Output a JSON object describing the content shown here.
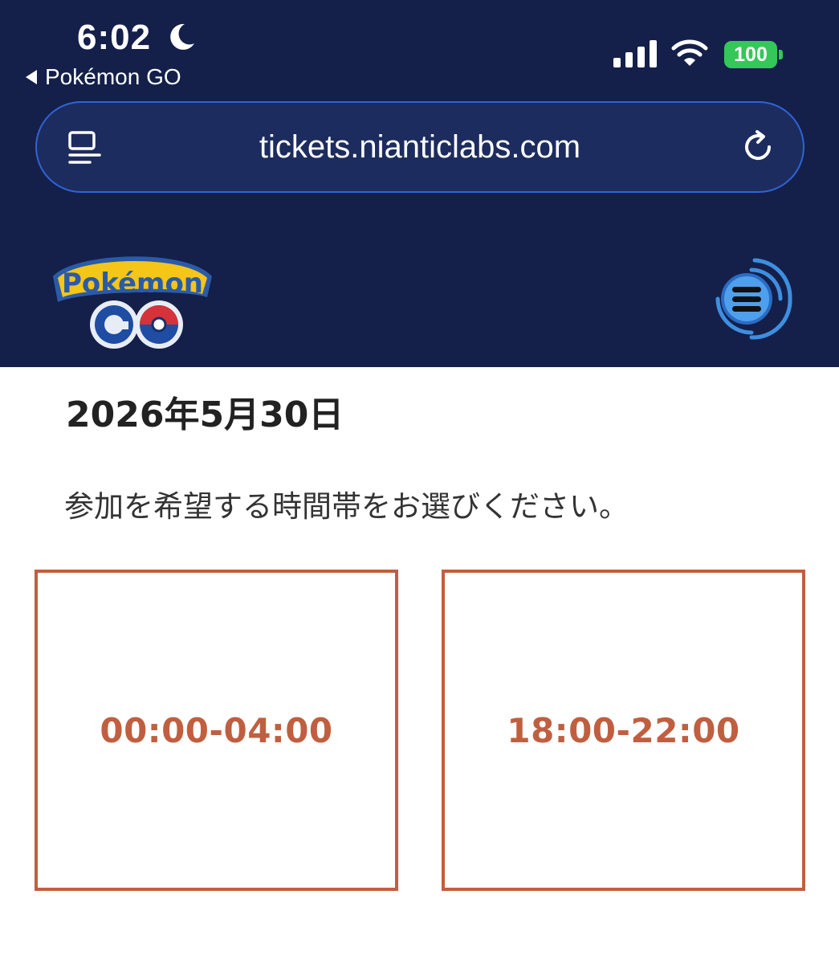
{
  "status_bar": {
    "time": "6:02",
    "back_app": "Pokémon GO",
    "battery": "100"
  },
  "browser": {
    "url": "tickets.nianticlabs.com"
  },
  "site_header": {
    "logo_icon": "pokemon-go-logo",
    "menu_icon": "menu-icon"
  },
  "content": {
    "date": "2026年5月30日",
    "prompt": "参加を希望する時間帯をお選びください。",
    "slots": [
      {
        "label": "00:00-04:00"
      },
      {
        "label": "18:00-22:00"
      }
    ]
  },
  "colors": {
    "header_bg": "#14204a",
    "accent": "#c05f40",
    "battery": "#35c759",
    "url_border": "#2f63d6"
  }
}
